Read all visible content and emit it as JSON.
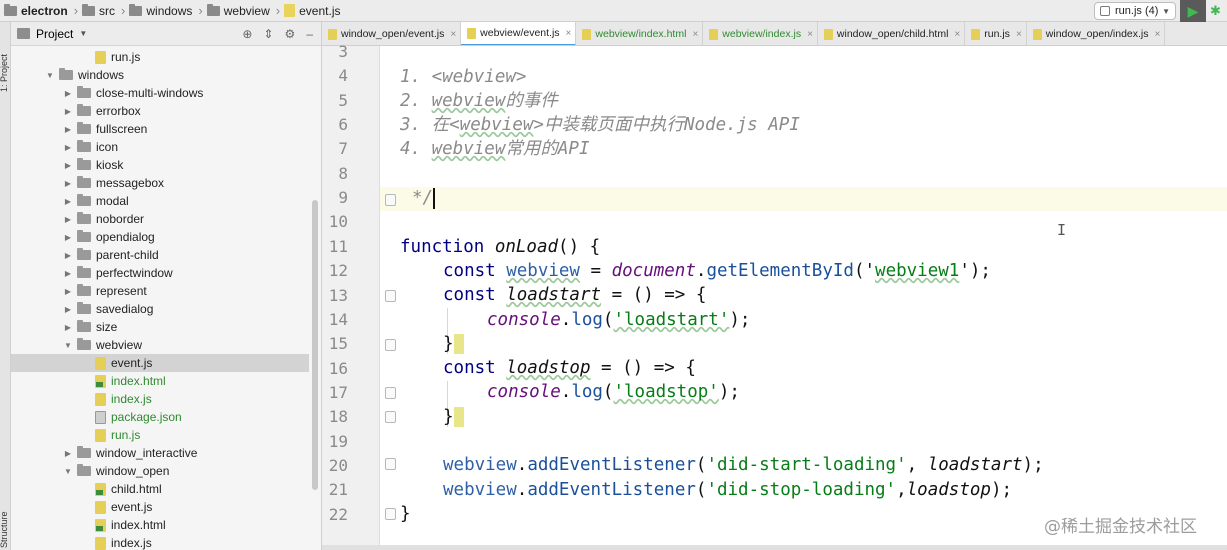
{
  "breadcrumb": [
    {
      "label": "electron",
      "kind": "folder"
    },
    {
      "label": "src",
      "kind": "folder"
    },
    {
      "label": "windows",
      "kind": "folder"
    },
    {
      "label": "webview",
      "kind": "folder"
    },
    {
      "label": "event.js",
      "kind": "file"
    }
  ],
  "run_config": {
    "label": "run.js (4)"
  },
  "left_strip": {
    "project_label": "1: Project",
    "structure_label": "Structure"
  },
  "project_panel": {
    "title": "Project",
    "tree": [
      {
        "label": "run.js",
        "type": "js",
        "depth": 3,
        "expand": ""
      },
      {
        "label": "windows",
        "type": "folder",
        "depth": 1,
        "expand": "open"
      },
      {
        "label": "close-multi-windows",
        "type": "folder",
        "depth": 2,
        "expand": "closed"
      },
      {
        "label": "errorbox",
        "type": "folder",
        "depth": 2,
        "expand": "closed"
      },
      {
        "label": "fullscreen",
        "type": "folder",
        "depth": 2,
        "expand": "closed"
      },
      {
        "label": "icon",
        "type": "folder",
        "depth": 2,
        "expand": "closed"
      },
      {
        "label": "kiosk",
        "type": "folder",
        "depth": 2,
        "expand": "closed"
      },
      {
        "label": "messagebox",
        "type": "folder",
        "depth": 2,
        "expand": "closed"
      },
      {
        "label": "modal",
        "type": "folder",
        "depth": 2,
        "expand": "closed"
      },
      {
        "label": "noborder",
        "type": "folder",
        "depth": 2,
        "expand": "closed"
      },
      {
        "label": "opendialog",
        "type": "folder",
        "depth": 2,
        "expand": "closed"
      },
      {
        "label": "parent-child",
        "type": "folder",
        "depth": 2,
        "expand": "closed"
      },
      {
        "label": "perfectwindow",
        "type": "folder",
        "depth": 2,
        "expand": "closed"
      },
      {
        "label": "represent",
        "type": "folder",
        "depth": 2,
        "expand": "closed"
      },
      {
        "label": "savedialog",
        "type": "folder",
        "depth": 2,
        "expand": "closed"
      },
      {
        "label": "size",
        "type": "folder",
        "depth": 2,
        "expand": "closed"
      },
      {
        "label": "webview",
        "type": "folder",
        "depth": 2,
        "expand": "open"
      },
      {
        "label": "event.js",
        "type": "js",
        "depth": 3,
        "expand": "",
        "selected": true
      },
      {
        "label": "index.html",
        "type": "html",
        "depth": 3,
        "expand": "",
        "green": true
      },
      {
        "label": "index.js",
        "type": "js",
        "depth": 3,
        "expand": "",
        "green": true
      },
      {
        "label": "package.json",
        "type": "json",
        "depth": 3,
        "expand": "",
        "green": true
      },
      {
        "label": "run.js",
        "type": "js",
        "depth": 3,
        "expand": "",
        "green": true
      },
      {
        "label": "window_interactive",
        "type": "folder",
        "depth": 2,
        "expand": "closed"
      },
      {
        "label": "window_open",
        "type": "folder",
        "depth": 2,
        "expand": "open"
      },
      {
        "label": "child.html",
        "type": "html",
        "depth": 3,
        "expand": ""
      },
      {
        "label": "event.js",
        "type": "js",
        "depth": 3,
        "expand": ""
      },
      {
        "label": "index.html",
        "type": "html",
        "depth": 3,
        "expand": ""
      },
      {
        "label": "index.js",
        "type": "js",
        "depth": 3,
        "expand": ""
      }
    ]
  },
  "tabs": [
    {
      "label": "window_open/event.js",
      "active": false,
      "green": false
    },
    {
      "label": "webview/event.js",
      "active": true,
      "green": false
    },
    {
      "label": "webview/index.html",
      "active": false,
      "green": true
    },
    {
      "label": "webview/index.js",
      "active": false,
      "green": true
    },
    {
      "label": "window_open/child.html",
      "active": false,
      "green": false
    },
    {
      "label": "run.js",
      "active": false,
      "green": false
    },
    {
      "label": "window_open/index.js",
      "active": false,
      "green": false
    }
  ],
  "editor": {
    "line_numbers": [
      "3",
      "4",
      "5",
      "6",
      "7",
      "8",
      "9",
      "10",
      "11",
      "12",
      "13",
      "14",
      "15",
      "16",
      "17",
      "18",
      "19",
      "20",
      "21",
      "22"
    ],
    "lines": {
      "l4": "1. <webview>",
      "l5a": "2. ",
      "l5b": "webview",
      "l5c": "的事件",
      "l6a": "3. 在<",
      "l6b": "webview",
      "l6c": ">中装载页面中执行Node.js API",
      "l7a": "4. ",
      "l7b": "webview",
      "l7c": "常用的API",
      "l9": "*/",
      "l11a": "function ",
      "l11b": "onLoad",
      "l11c": "() {",
      "l12a": "const ",
      "l12b": "webview",
      "l12c": " = ",
      "l12d": "document",
      "l12e": ".",
      "l12f": "getElementById",
      "l12g": "('",
      "l12h": "webview1",
      "l12i": "');",
      "l13a": "const ",
      "l13b": "loadstart",
      "l13c": " = () => {",
      "l14a": "console",
      "l14b": ".",
      "l14c": "log",
      "l14d": "(",
      "l14e": "'loadstart'",
      "l14f": ");",
      "l15": "}",
      "l16a": "const ",
      "l16b": "loadstop",
      "l16c": " = () => {",
      "l17a": "console",
      "l17b": ".",
      "l17c": "log",
      "l17d": "(",
      "l17e": "'loadstop'",
      "l17f": ");",
      "l18": "}",
      "l20a": "webview",
      "l20b": ".",
      "l20c": "addEventListener",
      "l20d": "(",
      "l20e": "'did-start-loading'",
      "l20f": ", ",
      "l20g": "loadstart",
      "l20h": ");",
      "l21a": "webview",
      "l21b": ".",
      "l21c": "addEventListener",
      "l21d": "(",
      "l21e": "'did-stop-loading'",
      "l21f": ",",
      "l21g": "loadstop",
      "l21h": ");",
      "l22": "}"
    }
  },
  "watermark": "@稀土掘金技术社区"
}
